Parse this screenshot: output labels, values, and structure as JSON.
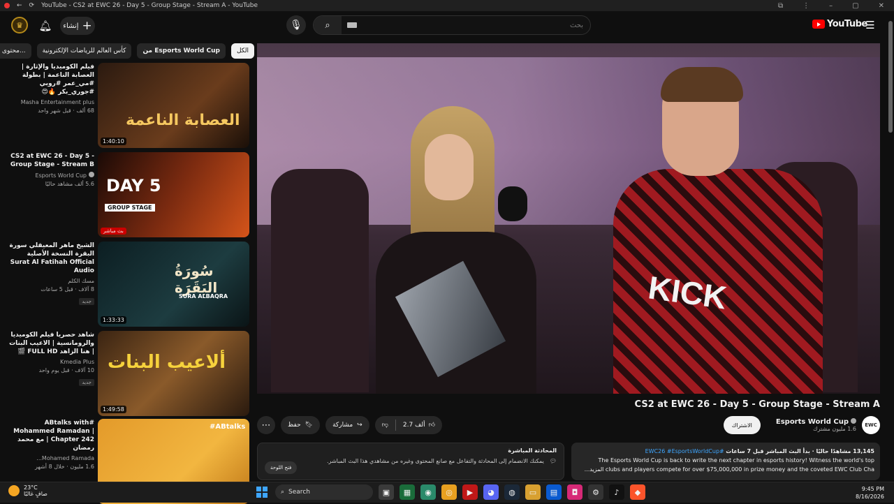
{
  "window": {
    "title": "YouTube - CS2 at EWC 26 - Day 5 - Group Stage - Stream A - YouTube"
  },
  "header": {
    "create_label": "إنشاء",
    "search_placeholder": "بحث",
    "logo_text": "YouTube"
  },
  "chips": [
    {
      "label": "الكل",
      "active": true
    },
    {
      "label": "من Esports World Cup",
      "bold": true
    },
    {
      "label": "كأس العالم للرياضات الإلكترونية"
    },
    {
      "label": "محتوى مشا..."
    }
  ],
  "recommendations": [
    {
      "title": "فيلم الكوميديا والإثارة | العصابة الناعمة | بطولة #مي_عمر #روبي #جوري_بكر 🔥😍",
      "channel": "Masha Entertainment plus",
      "stats": "68 ألف · قبل شهر واحد",
      "duration": "1:40:10",
      "thumb_text": "العصابة الناعمة"
    },
    {
      "title": "CS2 at EWC 26 - Day 5 - Group Stage - Stream B",
      "channel": "Esports World Cup",
      "stats": "5.6 ألف مشاهد حاليًا",
      "badge": "بث مباشر",
      "thumb_text": "DAY 5",
      "thumb_sub": "GROUP STAGE"
    },
    {
      "title": "الشيخ ماهر المعيقلي سورة البقرة النسخة الأصلية Surat Al Fatihah Official Audio",
      "channel": "مسك الكلم",
      "stats": "8 آلاف · قبل 5 ساعات",
      "tag": "جديد",
      "duration": "1:33:33",
      "thumb_text": "سُورَةُ البَقَرَة",
      "thumb_sub": "SURA ALBAQRA"
    },
    {
      "title": "شاهد حصريا فيلم الكوميديا والرومانسية | الاعيب البنات | هنا الزاهد FULL HD 🎬",
      "channel": "Kmedia Plus",
      "stats": "10 آلاف · قبل يوم واحد",
      "tag": "جديد",
      "duration": "1:49:58",
      "thumb_text": "ألاعيب البنات"
    },
    {
      "title": "#ABtalks with Mohammed Ramadan | Chapter 242 | مع محمد رمضان",
      "channel": "Mohamed Ramada...",
      "stats": "1.6 مليون · خلال 8 أشهر",
      "thumb_text": "#ABtalks"
    }
  ],
  "video": {
    "title": "CS2 at EWC 26 - Day 5 - Group Stage - Stream A",
    "channel_name": "Esports World Cup",
    "channel_subs": "1.6 مليون مشترك",
    "avatar_text": "EWC",
    "subscribe_label": "الاشتراك",
    "likes": "2.7 ألف",
    "share_label": "مشاركة",
    "save_label": "حفظ"
  },
  "description": {
    "stats": "13,145 مشاهدًا حاليًا · بدأ البث المباشر قبل 7 ساعات",
    "tags": "#EWC26 #EsportsWorldCup",
    "line1": "The Esports World Cup is back to write the next chapter in esports history! Witness the world's top",
    "line2": "clubs and players compete for over $75,000,000 in prize money and the coveted EWC Club Cha",
    "more": "...المزيد"
  },
  "chat": {
    "title": "المحادثة المباشرة",
    "body": "يمكنك الانضمام إلى المحادثة والتفاعل مع صانع المحتوى وغيره من مشاهدي هذا البث المباشر.",
    "open_label": "فتح اللوحة"
  },
  "taskbar": {
    "temp": "23°C",
    "weather_desc": "صافٍ غالبًا",
    "search_label": "Search",
    "time": "9:45 PM",
    "date": "8/16/2026"
  },
  "colors": {
    "accent_red": "#ff0000",
    "link_blue": "#3ea6ff",
    "bg": "#0f0f0f"
  }
}
